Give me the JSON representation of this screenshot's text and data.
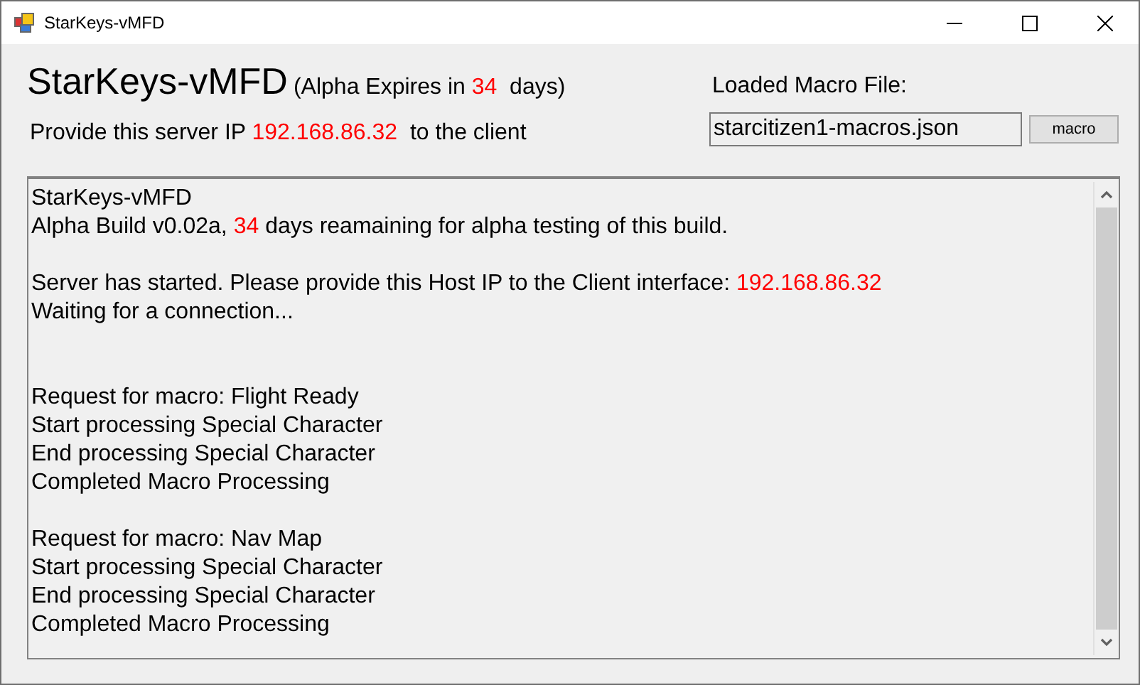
{
  "window": {
    "title": "StarKeys-vMFD"
  },
  "header": {
    "app_name": "StarKeys-vMFD",
    "expiry_prefix": "(Alpha Expires in",
    "expiry_days": "34",
    "expiry_suffix": "days)",
    "ip_prefix": "Provide this server IP",
    "ip": "192.168.86.32",
    "ip_suffix": "to the client"
  },
  "macro_file": {
    "label": "Loaded Macro File:",
    "value": "starcitizen1-macros.json",
    "button": "macro"
  },
  "log": [
    {
      "kind": "line",
      "parts": [
        {
          "text": "StarKeys-vMFD",
          "highlight": false
        }
      ]
    },
    {
      "kind": "line",
      "parts": [
        {
          "text": "Alpha Build v0.02a, ",
          "highlight": false
        },
        {
          "text": "34",
          "highlight": true
        },
        {
          "text": " days reamaining for alpha testing of this build.",
          "highlight": false
        }
      ]
    },
    {
      "kind": "blank"
    },
    {
      "kind": "line",
      "parts": [
        {
          "text": "Server has started. Please provide this Host IP to the Client interface: ",
          "highlight": false
        },
        {
          "text": "192.168.86.32",
          "highlight": true
        }
      ]
    },
    {
      "kind": "line",
      "parts": [
        {
          "text": "Waiting for a connection...",
          "highlight": false
        }
      ]
    },
    {
      "kind": "blank"
    },
    {
      "kind": "blank"
    },
    {
      "kind": "line",
      "parts": [
        {
          "text": "Request for macro: Flight Ready",
          "highlight": false
        }
      ]
    },
    {
      "kind": "line",
      "parts": [
        {
          "text": "Start processing Special Character",
          "highlight": false
        }
      ]
    },
    {
      "kind": "line",
      "parts": [
        {
          "text": "End processing Special Character",
          "highlight": false
        }
      ]
    },
    {
      "kind": "line",
      "parts": [
        {
          "text": "Completed Macro Processing",
          "highlight": false
        }
      ]
    },
    {
      "kind": "blank"
    },
    {
      "kind": "line",
      "parts": [
        {
          "text": "Request for macro: Nav Map",
          "highlight": false
        }
      ]
    },
    {
      "kind": "line",
      "parts": [
        {
          "text": "Start processing Special Character",
          "highlight": false
        }
      ]
    },
    {
      "kind": "line",
      "parts": [
        {
          "text": "End processing Special Character",
          "highlight": false
        }
      ]
    },
    {
      "kind": "line",
      "parts": [
        {
          "text": "Completed Macro Processing",
          "highlight": false
        }
      ]
    }
  ]
}
